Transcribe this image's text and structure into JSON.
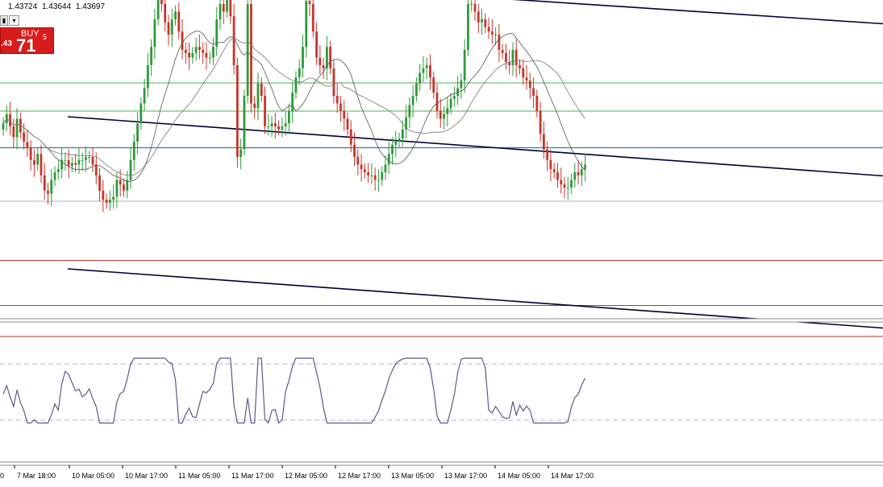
{
  "header": {
    "prices": [
      "1.43724",
      "1.43644",
      "1.43697"
    ]
  },
  "toolbar": {
    "button_a": "▮",
    "button_b": "▾"
  },
  "buy_panel": {
    "label": "BUY",
    "price_prefix": ".43",
    "price_big": "71",
    "price_sup": "5"
  },
  "x_axis": {
    "labels": [
      "7 Mar 18:00",
      "10 Mar 05:00",
      "10 Mar 17:00",
      "11 Mar 05:00",
      "11 Mar 17:00",
      "12 Mar 05:00",
      "12 Mar 17:00",
      "13 Mar 05:00",
      "13 Mar 17:00",
      "14 Mar 05:00",
      "14 Mar 17:00"
    ],
    "partial_first": "0"
  },
  "colors": {
    "bull": "#2e9a3a",
    "bear": "#c8342c",
    "green_level": "#4caf50",
    "blue_level": "#2e7ba8",
    "red_level": "#b33a2e",
    "grey_level": "#9a9a9a",
    "channel": "#000033",
    "ma": "#555555",
    "osc_line": "#5a5a8c",
    "osc_level": "#b6b0d2",
    "buy_panel": "#d81b1b"
  },
  "chart_data": {
    "type": "candlestick",
    "closes": [
      72,
      78,
      70,
      63,
      75,
      66,
      60,
      56,
      48,
      45,
      52,
      38,
      28,
      26,
      35,
      40,
      42,
      48,
      48,
      44,
      46,
      45,
      48,
      48,
      50,
      50,
      45,
      38,
      28,
      22,
      20,
      22,
      24,
      35,
      32,
      28,
      35,
      48,
      60,
      72,
      85,
      95,
      110,
      122,
      140,
      162,
      150,
      138,
      130,
      140,
      145,
      132,
      120,
      118,
      115,
      118,
      122,
      120,
      118,
      115,
      115,
      122,
      140,
      150,
      145,
      160,
      142,
      110,
      50,
      55,
      90,
      150,
      85,
      82,
      98,
      90,
      70,
      70,
      72,
      70,
      68,
      70,
      72,
      80,
      92,
      102,
      108,
      122,
      152,
      150,
      132,
      115,
      110,
      108,
      122,
      108,
      90,
      85,
      80,
      75,
      68,
      58,
      50,
      45,
      42,
      40,
      38,
      38,
      35,
      35,
      40,
      45,
      52,
      58,
      60,
      62,
      68,
      76,
      84,
      90,
      98,
      105,
      108,
      110,
      102,
      92,
      80,
      75,
      78,
      82,
      88,
      90,
      95,
      100,
      120,
      150,
      150,
      145,
      138,
      140,
      135,
      132,
      130,
      130,
      120,
      118,
      112,
      110,
      120,
      110,
      108,
      102,
      100,
      95,
      90,
      80,
      65,
      55,
      48,
      42,
      40,
      35,
      32,
      30,
      30,
      35,
      40,
      38,
      42,
      45
    ],
    "levels": {
      "green": [
        1.4395,
        1.4385
      ],
      "blue": 1.4372,
      "grey": 1.4353,
      "red": [
        1.4332,
        1.4316,
        1.4305
      ]
    },
    "channel_lines": [
      {
        "name": "upper",
        "points": [
          [
            "7 Mar",
            1.4435
          ],
          [
            "15 Mar",
            1.4416
          ]
        ]
      },
      {
        "name": "middle",
        "points": [
          [
            "7 Mar",
            1.4383
          ],
          [
            "15 Mar",
            1.4362
          ]
        ]
      },
      {
        "name": "lower",
        "points": [
          [
            "7 Mar",
            1.4329
          ],
          [
            "15 Mar",
            1.4308
          ]
        ]
      }
    ],
    "oscillator": {
      "levels": [
        70,
        30
      ]
    }
  }
}
